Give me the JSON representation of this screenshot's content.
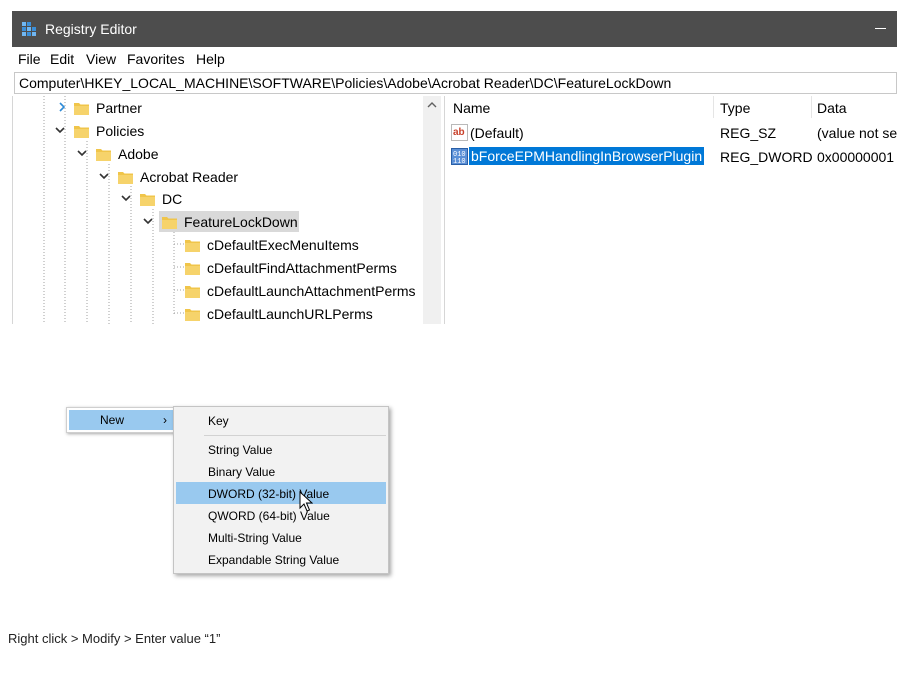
{
  "window": {
    "title": "Registry Editor",
    "menu": [
      "File",
      "Edit",
      "View",
      "Favorites",
      "Help"
    ],
    "address": "Computer\\HKEY_LOCAL_MACHINE\\SOFTWARE\\Policies\\Adobe\\Acrobat Reader\\DC\\FeatureLockDown"
  },
  "tree": {
    "items": [
      {
        "label": "Partner",
        "state": "collapsed"
      },
      {
        "label": "Policies",
        "state": "expanded"
      },
      {
        "label": "Adobe",
        "state": "expanded"
      },
      {
        "label": "Acrobat Reader",
        "state": "expanded"
      },
      {
        "label": "DC",
        "state": "expanded"
      },
      {
        "label": "FeatureLockDown",
        "state": "expanded",
        "selected": true
      },
      {
        "label": "cDefaultExecMenuItems",
        "state": "leaf"
      },
      {
        "label": "cDefaultFindAttachmentPerms",
        "state": "leaf"
      },
      {
        "label": "cDefaultLaunchAttachmentPerms",
        "state": "leaf"
      },
      {
        "label": "cDefaultLaunchURLPerms",
        "state": "leaf"
      }
    ]
  },
  "values": {
    "columns": [
      "Name",
      "Type",
      "Data"
    ],
    "rows": [
      {
        "name": "(Default)",
        "type": "REG_SZ",
        "data": "(value not se",
        "icon": "string-value-icon"
      },
      {
        "name": "bForceEPMHandlingInBrowserPlugin",
        "type": "REG_DWORD",
        "data": "0x00000001",
        "icon": "binary-value-icon",
        "selected": true
      }
    ]
  },
  "context_menu": {
    "parent_label": "New",
    "parent_arrow": "›",
    "items": [
      {
        "label": "Key"
      },
      {
        "label": "String Value"
      },
      {
        "label": "Binary Value"
      },
      {
        "label": "DWORD (32-bit) Value",
        "highlighted": true
      },
      {
        "label": "QWORD (64-bit) Value"
      },
      {
        "label": "Multi-String Value"
      },
      {
        "label": "Expandable String Value"
      }
    ]
  },
  "caption": "Right click > Modify > Enter value “1”",
  "colors": {
    "titlebar": "#4d4d4d",
    "selection": "#0078d7",
    "menu_highlight": "#99c9ef",
    "folder": "#f0c54a"
  }
}
